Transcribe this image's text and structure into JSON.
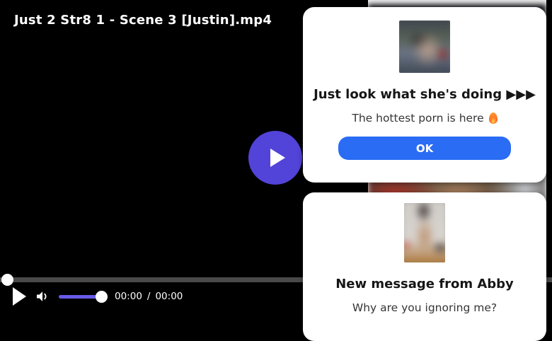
{
  "player": {
    "title": "Just 2 Str8 1 - Scene 3 [Justin].mp4",
    "controls": {
      "current_time": "00:00",
      "time_separator": "/",
      "duration": "00:00"
    },
    "colors": {
      "big_play_button": "#5243d9",
      "volume_fill": "#685ae8",
      "progress_track": "#4a4a4a"
    }
  },
  "ads": {
    "popup1": {
      "title": "Just look what she's doing ▶▶▶",
      "subtitle": "The hottest porn is here",
      "fire_emoji": "🔥",
      "ok_label": "OK",
      "button_color": "#2a6cf4"
    },
    "popup2": {
      "title": "New message from Abby",
      "subtitle": "Why are you ignoring me?"
    }
  }
}
